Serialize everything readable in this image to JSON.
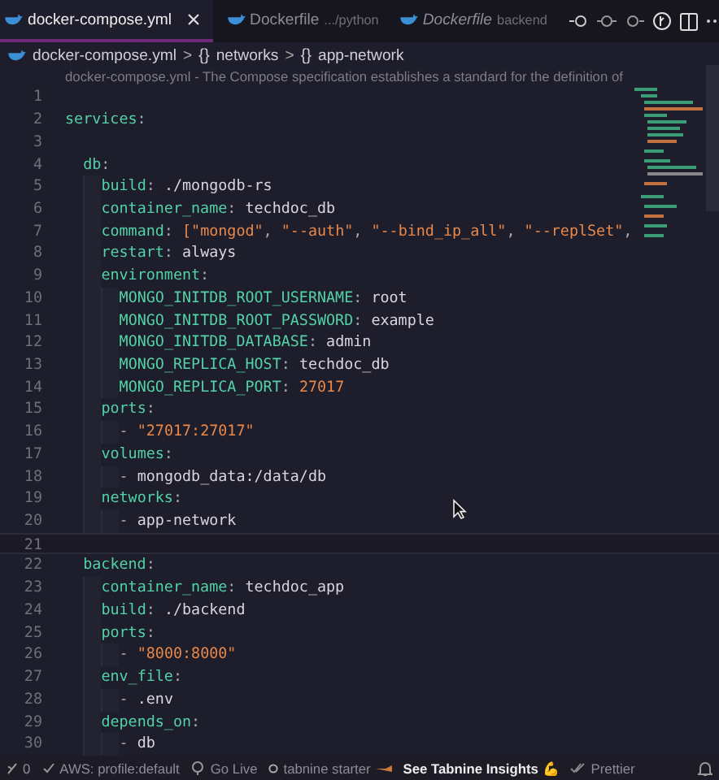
{
  "tabs": [
    {
      "label": "docker-compose.yml",
      "selected": true,
      "preview": false,
      "closable": true
    },
    {
      "label": "Dockerfile",
      "description": ".../python",
      "selected": false,
      "preview": false,
      "closable": false
    },
    {
      "label": "Dockerfile",
      "description": "backend",
      "selected": false,
      "preview": true,
      "closable": false
    }
  ],
  "breadcrumbs": [
    {
      "kind": "file",
      "label": "docker-compose.yml"
    },
    {
      "kind": "object",
      "label": "networks"
    },
    {
      "kind": "object",
      "label": "app-network"
    }
  ],
  "breadcrumb_separator": ">",
  "object_symbol": "{}",
  "schema_hint": "docker-compose.yml - The Compose specification establishes a standard for the definition of",
  "lines": [
    {
      "number": "1"
    },
    {
      "number": "2",
      "tokens": [
        {
          "kind": "key",
          "s": "services"
        },
        {
          "kind": "punct",
          "s": ":"
        }
      ],
      "children": [
        {
          "number": "3"
        },
        {
          "number": "4",
          "tokens": [
            {
              "kind": "key",
              "s": "db"
            },
            {
              "kind": "punct",
              "s": ":"
            }
          ],
          "children": [
            {
              "number": "5",
              "tokens": [
                {
                  "kind": "key",
                  "s": "build"
                },
                {
                  "kind": "punct",
                  "s": ": "
                },
                {
                  "kind": "value",
                  "s": "./mongodb-rs"
                }
              ]
            },
            {
              "number": "6",
              "tokens": [
                {
                  "kind": "key",
                  "s": "container_name"
                },
                {
                  "kind": "punct",
                  "s": ": "
                },
                {
                  "kind": "value",
                  "s": "techdoc_db"
                }
              ]
            },
            {
              "number": "7",
              "tokens": [
                {
                  "kind": "key",
                  "s": "command"
                },
                {
                  "kind": "punct",
                  "s": ": "
                },
                {
                  "kind": "string",
                  "s": "[\"mongod\""
                },
                {
                  "kind": "punct",
                  "s": ", "
                },
                {
                  "kind": "string",
                  "s": "\"--auth\""
                },
                {
                  "kind": "punct",
                  "s": ", "
                },
                {
                  "kind": "string",
                  "s": "\"--bind_ip_all\""
                },
                {
                  "kind": "punct",
                  "s": ", "
                },
                {
                  "kind": "string",
                  "s": "\"--replSet\""
                },
                {
                  "kind": "punct",
                  "s": ","
                }
              ]
            },
            {
              "number": "8",
              "tokens": [
                {
                  "kind": "key",
                  "s": "restart"
                },
                {
                  "kind": "punct",
                  "s": ": "
                },
                {
                  "kind": "value",
                  "s": "always"
                }
              ]
            },
            {
              "number": "9",
              "tokens": [
                {
                  "kind": "key",
                  "s": "environment"
                },
                {
                  "kind": "punct",
                  "s": ":"
                }
              ],
              "children": [
                {
                  "number": "10",
                  "tokens": [
                    {
                      "kind": "key",
                      "s": "MONGO_INITDB_ROOT_USERNAME"
                    },
                    {
                      "kind": "punct",
                      "s": ": "
                    },
                    {
                      "kind": "value",
                      "s": "root"
                    }
                  ]
                },
                {
                  "number": "11",
                  "tokens": [
                    {
                      "kind": "key",
                      "s": "MONGO_INITDB_ROOT_PASSWORD"
                    },
                    {
                      "kind": "punct",
                      "s": ": "
                    },
                    {
                      "kind": "value",
                      "s": "example"
                    }
                  ]
                },
                {
                  "number": "12",
                  "tokens": [
                    {
                      "kind": "key",
                      "s": "MONGO_INITDB_DATABASE"
                    },
                    {
                      "kind": "punct",
                      "s": ": "
                    },
                    {
                      "kind": "value",
                      "s": "admin"
                    }
                  ]
                },
                {
                  "number": "13",
                  "tokens": [
                    {
                      "kind": "key",
                      "s": "MONGO_REPLICA_HOST"
                    },
                    {
                      "kind": "punct",
                      "s": ": "
                    },
                    {
                      "kind": "value",
                      "s": "techdoc_db"
                    }
                  ]
                },
                {
                  "number": "14",
                  "tokens": [
                    {
                      "kind": "key",
                      "s": "MONGO_REPLICA_PORT"
                    },
                    {
                      "kind": "punct",
                      "s": ": "
                    },
                    {
                      "kind": "number",
                      "s": "27017"
                    }
                  ]
                }
              ]
            },
            {
              "number": "15",
              "tokens": [
                {
                  "kind": "key",
                  "s": "ports"
                },
                {
                  "kind": "punct",
                  "s": ":"
                }
              ],
              "children": [
                {
                  "number": "16",
                  "tokens": [
                    {
                      "kind": "punct",
                      "s": "- "
                    },
                    {
                      "kind": "string",
                      "s": "\"27017:27017\""
                    }
                  ]
                }
              ]
            },
            {
              "number": "17",
              "tokens": [
                {
                  "kind": "key",
                  "s": "volumes"
                },
                {
                  "kind": "punct",
                  "s": ":"
                }
              ],
              "children": [
                {
                  "number": "18",
                  "tokens": [
                    {
                      "kind": "punct",
                      "s": "- "
                    },
                    {
                      "kind": "value",
                      "s": "mongodb_data:/data/db"
                    }
                  ]
                }
              ]
            },
            {
              "number": "19",
              "tokens": [
                {
                  "kind": "key",
                  "s": "networks"
                },
                {
                  "kind": "punct",
                  "s": ":"
                }
              ],
              "children": [
                {
                  "number": "20",
                  "tokens": [
                    {
                      "kind": "punct",
                      "s": "- "
                    },
                    {
                      "kind": "value",
                      "s": "app-network"
                    }
                  ]
                }
              ]
            }
          ]
        },
        {
          "number": "21",
          "current": true
        },
        {
          "number": "22",
          "tokens": [
            {
              "kind": "key",
              "s": "backend"
            },
            {
              "kind": "punct",
              "s": ":"
            }
          ],
          "children": [
            {
              "number": "23",
              "tokens": [
                {
                  "kind": "key",
                  "s": "container_name"
                },
                {
                  "kind": "punct",
                  "s": ": "
                },
                {
                  "kind": "value",
                  "s": "techdoc_app"
                }
              ]
            },
            {
              "number": "24",
              "tokens": [
                {
                  "kind": "key",
                  "s": "build"
                },
                {
                  "kind": "punct",
                  "s": ": "
                },
                {
                  "kind": "value",
                  "s": "./backend"
                }
              ]
            },
            {
              "number": "25",
              "tokens": [
                {
                  "kind": "key",
                  "s": "ports"
                },
                {
                  "kind": "punct",
                  "s": ":"
                }
              ],
              "children": [
                {
                  "number": "26",
                  "tokens": [
                    {
                      "kind": "punct",
                      "s": "- "
                    },
                    {
                      "kind": "string",
                      "s": "\"8000:8000\""
                    }
                  ]
                }
              ]
            },
            {
              "number": "27",
              "tokens": [
                {
                  "kind": "key",
                  "s": "env_file"
                },
                {
                  "kind": "punct",
                  "s": ":"
                }
              ],
              "children": [
                {
                  "number": "28",
                  "tokens": [
                    {
                      "kind": "punct",
                      "s": "- "
                    },
                    {
                      "kind": "value",
                      "s": ".env"
                    }
                  ]
                }
              ]
            },
            {
              "number": "29",
              "tokens": [
                {
                  "kind": "key",
                  "s": "depends_on"
                },
                {
                  "kind": "punct",
                  "s": ":"
                }
              ],
              "children": [
                {
                  "number": "30",
                  "tokens": [
                    {
                      "kind": "punct",
                      "s": "- "
                    },
                    {
                      "kind": "value",
                      "s": "db"
                    }
                  ]
                }
              ]
            }
          ]
        }
      ]
    }
  ],
  "status_bar": [
    {
      "kind": "ports",
      "label": "0"
    },
    {
      "kind": "aws",
      "label": "AWS: profile:default"
    },
    {
      "kind": "live",
      "label": "Go Live"
    },
    {
      "kind": "tabnine",
      "label": "tabnine starter"
    },
    {
      "kind": "insights",
      "label": "See Tabnine Insights 💪"
    },
    {
      "kind": "prettier",
      "label": "Prettier"
    },
    {
      "kind": "bell"
    }
  ]
}
